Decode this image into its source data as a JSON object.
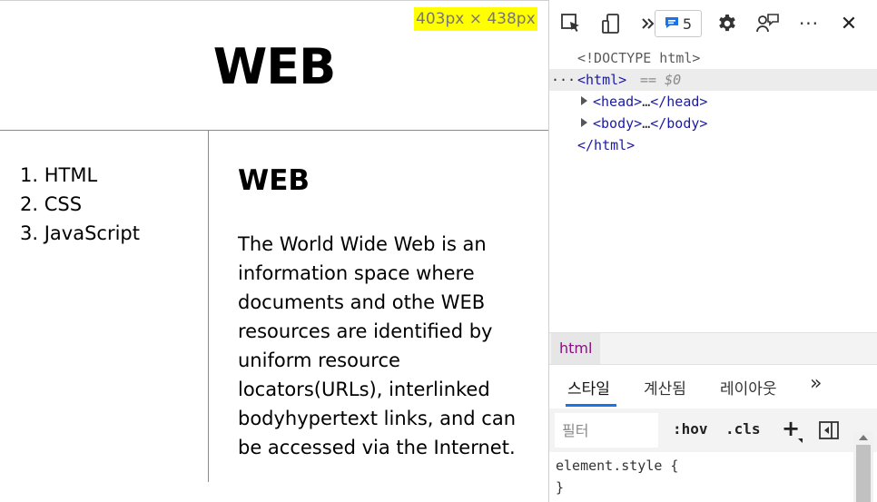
{
  "page": {
    "h1": "WEB",
    "nav_items": [
      "1. HTML",
      "2. CSS",
      "3. JavaScript"
    ],
    "h2": "WEB",
    "paragraph": "The World Wide Web is an information space where documents and othe WEB resources are identified by uniform resource locators(URLs), interlinked bodyhypertext links, and can be accessed via the Internet.",
    "size_badge": "403px × 438px",
    "badge_color": "#ffff00"
  },
  "devtools": {
    "toolbar": {
      "icons": [
        "inspect-element-icon",
        "device-emulation-icon",
        "more-tabs-icon",
        "issues-message-icon",
        "settings-gear-icon",
        "feedback-icon",
        "more-options-icon",
        "close-icon"
      ],
      "issues_count": "5",
      "more_options": "···",
      "close": "✕"
    },
    "dom": {
      "doctype": "<!DOCTYPE html>",
      "html_open": "<html>",
      "selected_marker": "== $0",
      "row_ellipsis": "···",
      "head": "<head>",
      "head_close": "</head>",
      "body": "<body>",
      "body_close": "</body>",
      "ellipsis": "…",
      "html_close": "</html>"
    },
    "breadcrumb": {
      "current": "html"
    },
    "tabs": {
      "styles": "스타일",
      "computed": "계산됨",
      "layout": "레이아웃",
      "more": "»"
    },
    "filter": {
      "placeholder": "필터",
      "hov": ":hov",
      "cls": ".cls",
      "add": "+"
    },
    "styles": {
      "rule_open": "element.style {",
      "rule_close": "}"
    },
    "colors": {
      "tag": "#1a1aa6",
      "accent": "#1a73e8",
      "breadcrumb_text": "#881280"
    }
  }
}
